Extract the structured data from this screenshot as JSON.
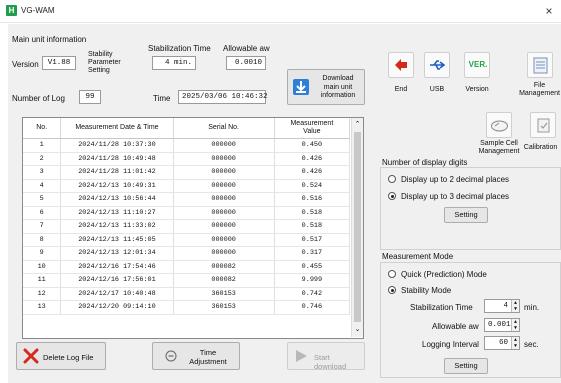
{
  "window": {
    "title": "VG-WAM",
    "app_icon": "H",
    "close_glyph": "×"
  },
  "main_info": {
    "group_title": "Main unit information",
    "version_label": "Version",
    "version_value": "V1.88",
    "stability_label": "Stability\nParameter\nSetting",
    "stab_time_header": "Stabilization Time",
    "allowable_header": "Allowable aw",
    "stab_time_value": "4",
    "stab_time_unit": "min.",
    "allowable_value": "0.0010",
    "num_log_label": "Number of Log",
    "num_log_value": "99",
    "time_label": "Time",
    "time_value": "2025/03/06 10:46:32",
    "download_button": "Download\nmain unit\ninformation"
  },
  "table": {
    "columns": [
      "No.",
      "Measurement Date & Time",
      "Serial No.",
      "Measurement\nValue"
    ],
    "rows": [
      [
        "1",
        "2024/11/28 10:37:30",
        "000000",
        "0.450"
      ],
      [
        "2",
        "2024/11/28 10:49:48",
        "000000",
        "0.426"
      ],
      [
        "3",
        "2024/11/28 11:01:42",
        "000000",
        "0.426"
      ],
      [
        "4",
        "2024/12/13 10:49:31",
        "000000",
        "0.524"
      ],
      [
        "5",
        "2024/12/13 10:56:44",
        "000000",
        "0.516"
      ],
      [
        "6",
        "2024/12/13 11:10:27",
        "000000",
        "0.518"
      ],
      [
        "7",
        "2024/12/13 11:33:02",
        "000000",
        "0.518"
      ],
      [
        "8",
        "2024/12/13 11:45:05",
        "000000",
        "0.517"
      ],
      [
        "9",
        "2024/12/13 12:01:34",
        "000000",
        "0.317"
      ],
      [
        "10",
        "2024/12/16 17:54:46",
        "000082",
        "0.455"
      ],
      [
        "11",
        "2024/12/16 17:56:01",
        "000082",
        "9.999"
      ],
      [
        "12",
        "2024/12/17 10:40:48",
        "360153",
        "0.742"
      ],
      [
        "13",
        "2024/12/20 09:14:10",
        "360153",
        "0.746"
      ]
    ]
  },
  "bottom": {
    "delete_label": "Delete Log File",
    "time_adjust_label": "Time\nAdjustment",
    "start_download_label": "Start download"
  },
  "toolbar": [
    {
      "label": "End",
      "icon": "end-icon"
    },
    {
      "label": "USB",
      "icon": "usb-icon"
    },
    {
      "label": "Version",
      "icon": "version-icon",
      "glyph": "VER."
    },
    {
      "label": "File\nManagement",
      "icon": "file-management-icon"
    }
  ],
  "toolbar2": [
    {
      "label": "Sample Cell\nManagement",
      "icon": "sample-cell-icon"
    },
    {
      "label": "Calibration",
      "icon": "calibration-icon"
    }
  ],
  "display_digits": {
    "title": "Number of display digits",
    "option1": "Display up to 2 decimal places",
    "option2": "Display up to 3 decimal places",
    "selected": "option2",
    "setting_button": "Setting"
  },
  "measurement_mode": {
    "title": "Measurement Mode",
    "option1": "Quick (Prediction) Mode",
    "option2": "Stability Mode",
    "selected": "option2",
    "stab_time_label": "Stabilization Time",
    "stab_time_value": "4",
    "stab_time_unit": "min.",
    "allowable_label": "Allowable aw",
    "allowable_value": "0.0010",
    "logging_label": "Logging Interval",
    "logging_value": "60",
    "logging_unit": "sec.",
    "setting_button": "Setting"
  },
  "colors": {
    "end_red": "#d42a1c",
    "usb_blue": "#1b5fc4",
    "ver_green": "#1fa64a",
    "download_blue": "#2f7fd8"
  }
}
